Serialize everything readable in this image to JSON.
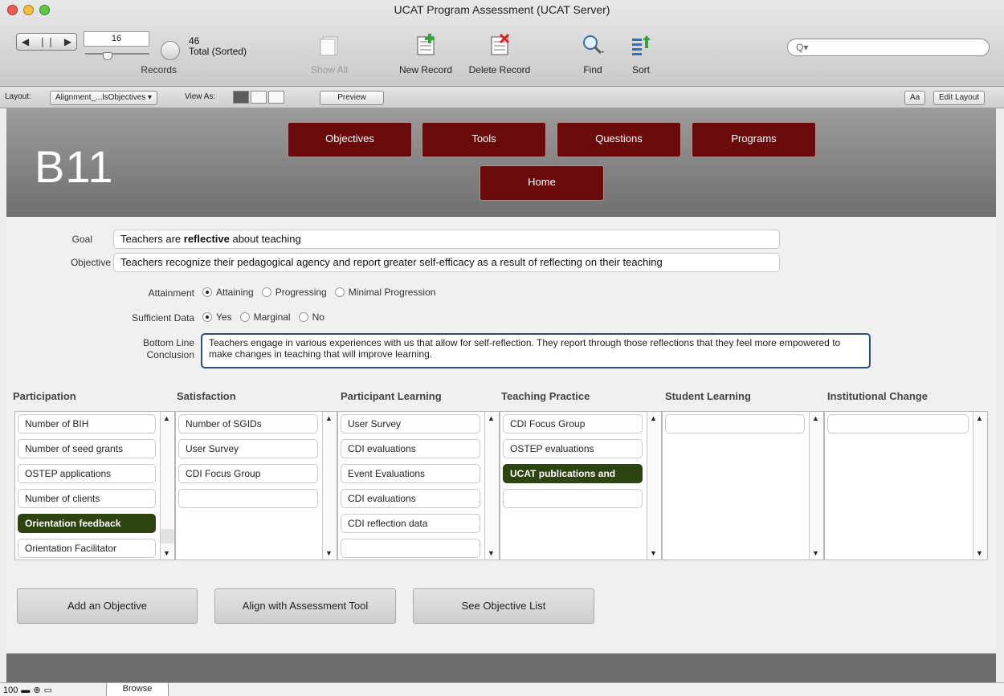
{
  "window": {
    "title": "UCAT Program Assessment (UCAT Server)"
  },
  "toolbar": {
    "record_number": "16",
    "total_count": "46",
    "total_label": "Total (Sorted)",
    "records_label": "Records",
    "show_all": "Show All",
    "new_record": "New Record",
    "delete_record": "Delete Record",
    "find": "Find",
    "sort": "Sort",
    "search_placeholder": "Q▾"
  },
  "layoutbar": {
    "layout_label": "Layout:",
    "layout_value": "Alignment_...lsObjectives ▾",
    "view_as_label": "View As:",
    "preview": "Preview",
    "font_btn": "Aa",
    "edit_layout": "Edit Layout"
  },
  "header": {
    "record_id": "B11",
    "nav": {
      "objectives": "Objectives",
      "tools": "Tools",
      "questions": "Questions",
      "programs": "Programs",
      "home": "Home"
    }
  },
  "form": {
    "goal_label": "Goal",
    "goal_prefix": "Teachers are ",
    "goal_bold": "reflective",
    "goal_suffix": " about teaching",
    "objective_label": "Objective",
    "objective_value": "Teachers recognize their pedagogical agency and report greater self-efficacy as a result of reflecting on their teaching",
    "attainment_label": "Attainment",
    "attainment_options": [
      "Attaining",
      "Progressing",
      "Minimal Progression"
    ],
    "sufficient_label": "Sufficient Data",
    "sufficient_options": [
      "Yes",
      "Marginal",
      "No"
    ],
    "bottom_line_label_1": "Bottom Line",
    "bottom_line_label_2": "Conclusion",
    "bottom_line_value": "Teachers engage in various experiences with us that allow for self-reflection. They report through those reflections that they feel more empowered to make changes in teaching that will improve learning."
  },
  "columns": {
    "participation": {
      "title": "Participation",
      "items": [
        "Number of BIH",
        "Number of seed grants",
        "OSTEP applications",
        "Number of clients",
        "Orientation feedback",
        "Orientation Facilitator"
      ]
    },
    "satisfaction": {
      "title": "Satisfaction",
      "items": [
        "Number of SGIDs",
        "User Survey",
        "CDI Focus Group",
        ""
      ]
    },
    "participant_learning": {
      "title": "Participant Learning",
      "items": [
        "User Survey",
        "CDI evaluations",
        "Event Evaluations",
        "CDI evaluations",
        "CDI reflection data",
        ""
      ]
    },
    "teaching_practice": {
      "title": "Teaching Practice",
      "items": [
        "CDI Focus Group",
        "OSTEP evaluations",
        "UCAT publications and",
        ""
      ]
    },
    "student_learning": {
      "title": "Student Learning",
      "items": [
        ""
      ]
    },
    "institutional_change": {
      "title": "Institutional Change",
      "items": [
        ""
      ]
    }
  },
  "actions": {
    "add_objective": "Add an Objective",
    "align": "Align with Assessment Tool",
    "see_list": "See Objective List"
  },
  "statusbar": {
    "zoom": "100",
    "mode": "Browse"
  }
}
